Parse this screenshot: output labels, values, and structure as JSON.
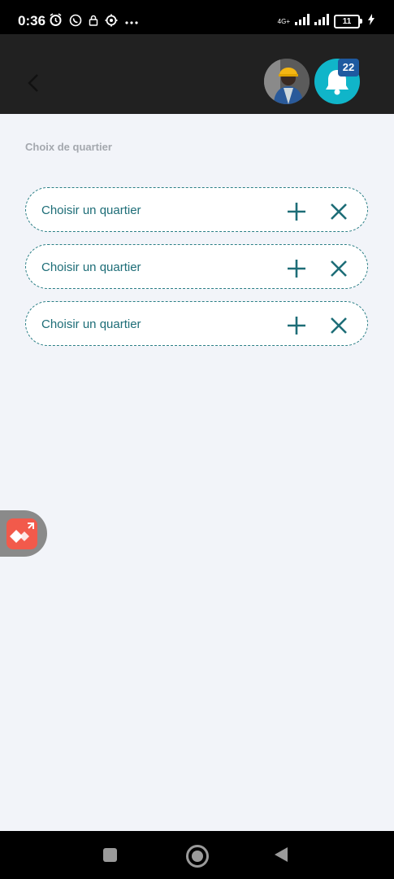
{
  "status_bar": {
    "time": "0:36",
    "network_label": "4G+",
    "battery": "11"
  },
  "app_bar": {
    "notification_count": "22",
    "accent_color": "#10b5c9"
  },
  "section": {
    "label": "Choix de quartier"
  },
  "pickers": [
    {
      "label": "Choisir un quartier"
    },
    {
      "label": "Choisir un quartier"
    },
    {
      "label": "Choisir un quartier"
    }
  ],
  "colors": {
    "teal": "#1d6d77",
    "background": "#f2f4f9",
    "app_bar": "#212121"
  }
}
